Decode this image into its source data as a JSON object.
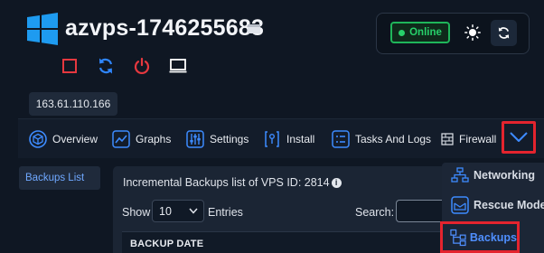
{
  "header": {
    "vps_name": "azvps-1746255683",
    "status": "Online",
    "ip": "163.61.110.166",
    "icons": [
      "windows-logo-icon",
      "flag-icon",
      "sun-icon",
      "refresh-icon",
      "stop-icon",
      "restart-icon",
      "power-icon",
      "console-icon"
    ]
  },
  "tabs": [
    {
      "label": "Overview",
      "icon": "cube-icon"
    },
    {
      "label": "Graphs",
      "icon": "chart-icon"
    },
    {
      "label": "Settings",
      "icon": "sliders-icon"
    },
    {
      "label": "Install",
      "icon": "install-icon"
    },
    {
      "label": "Tasks And Logs",
      "icon": "list-icon"
    },
    {
      "label": "Firewall",
      "icon": "firewall-icon"
    }
  ],
  "sidebar": {
    "items": [
      {
        "label": "Backups List"
      }
    ]
  },
  "panel": {
    "title": "Incremental Backups list of VPS ID: 2814",
    "show_label": "Show",
    "entries_value": "10",
    "entries_label": "Entries",
    "search_label": "Search:",
    "columns": [
      "BACKUP DATE"
    ]
  },
  "dropdown": {
    "items": [
      {
        "label": "Networking",
        "icon": "network-icon"
      },
      {
        "label": "Rescue Mode",
        "icon": "rescue-icon"
      },
      {
        "label": "Backups",
        "icon": "backups-icon"
      }
    ]
  },
  "colors": {
    "accent": "#4f8fff",
    "online": "#27d16a",
    "highlight": "#e4242e",
    "background": "#0f1723"
  }
}
